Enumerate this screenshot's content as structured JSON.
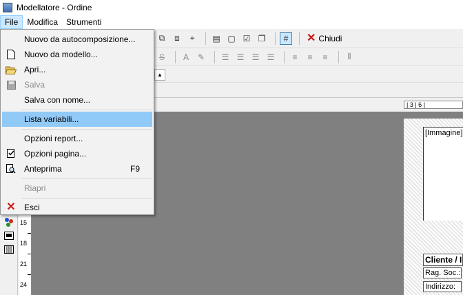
{
  "window": {
    "title": "Modellatore - Ordine",
    "app_icon": "modeler-app-icon"
  },
  "menubar": {
    "items": [
      {
        "label": "File",
        "state": "open"
      },
      {
        "label": "Modifica"
      },
      {
        "label": "Strumenti"
      }
    ]
  },
  "file_menu": {
    "items": [
      {
        "label": "Nuovo da autocomposizione...",
        "icon": "none"
      },
      {
        "label": "Nuovo da modello...",
        "icon": "new-document-icon"
      },
      {
        "label": "Apri...",
        "icon": "open-folder-icon"
      },
      {
        "label": "Salva",
        "icon": "save-disk-icon",
        "disabled": true
      },
      {
        "label": "Salva con nome...",
        "icon": "none"
      },
      {
        "label": "Lista variabili...",
        "icon": "none",
        "highlighted": true
      },
      {
        "label": "Opzioni report...",
        "icon": "none"
      },
      {
        "label": "Opzioni pagina...",
        "icon": "page-setup-icon"
      },
      {
        "label": "Anteprima",
        "icon": "print-preview-icon",
        "shortcut": "F9"
      },
      {
        "label": "Riapri",
        "icon": "none",
        "disabled": true
      },
      {
        "label": "Esci",
        "icon": "exit-x-icon"
      }
    ]
  },
  "toolbar": {
    "close_label": "Chiudi",
    "close_icon_color": "#cc1414"
  },
  "ruler": {
    "horizontal_labels": "| 3 | 6 |",
    "vertical_labels": [
      "15",
      "18",
      "21",
      "24"
    ]
  },
  "report": {
    "image_placeholder": "[Immagine]",
    "section_title": "Cliente / In",
    "fields": [
      "Rag. Soc.:",
      "Indirizzo:"
    ]
  },
  "colors": {
    "menu_highlight": "#91c9f7",
    "menubar_open": "#cce8ff",
    "workspace": "#808080"
  }
}
